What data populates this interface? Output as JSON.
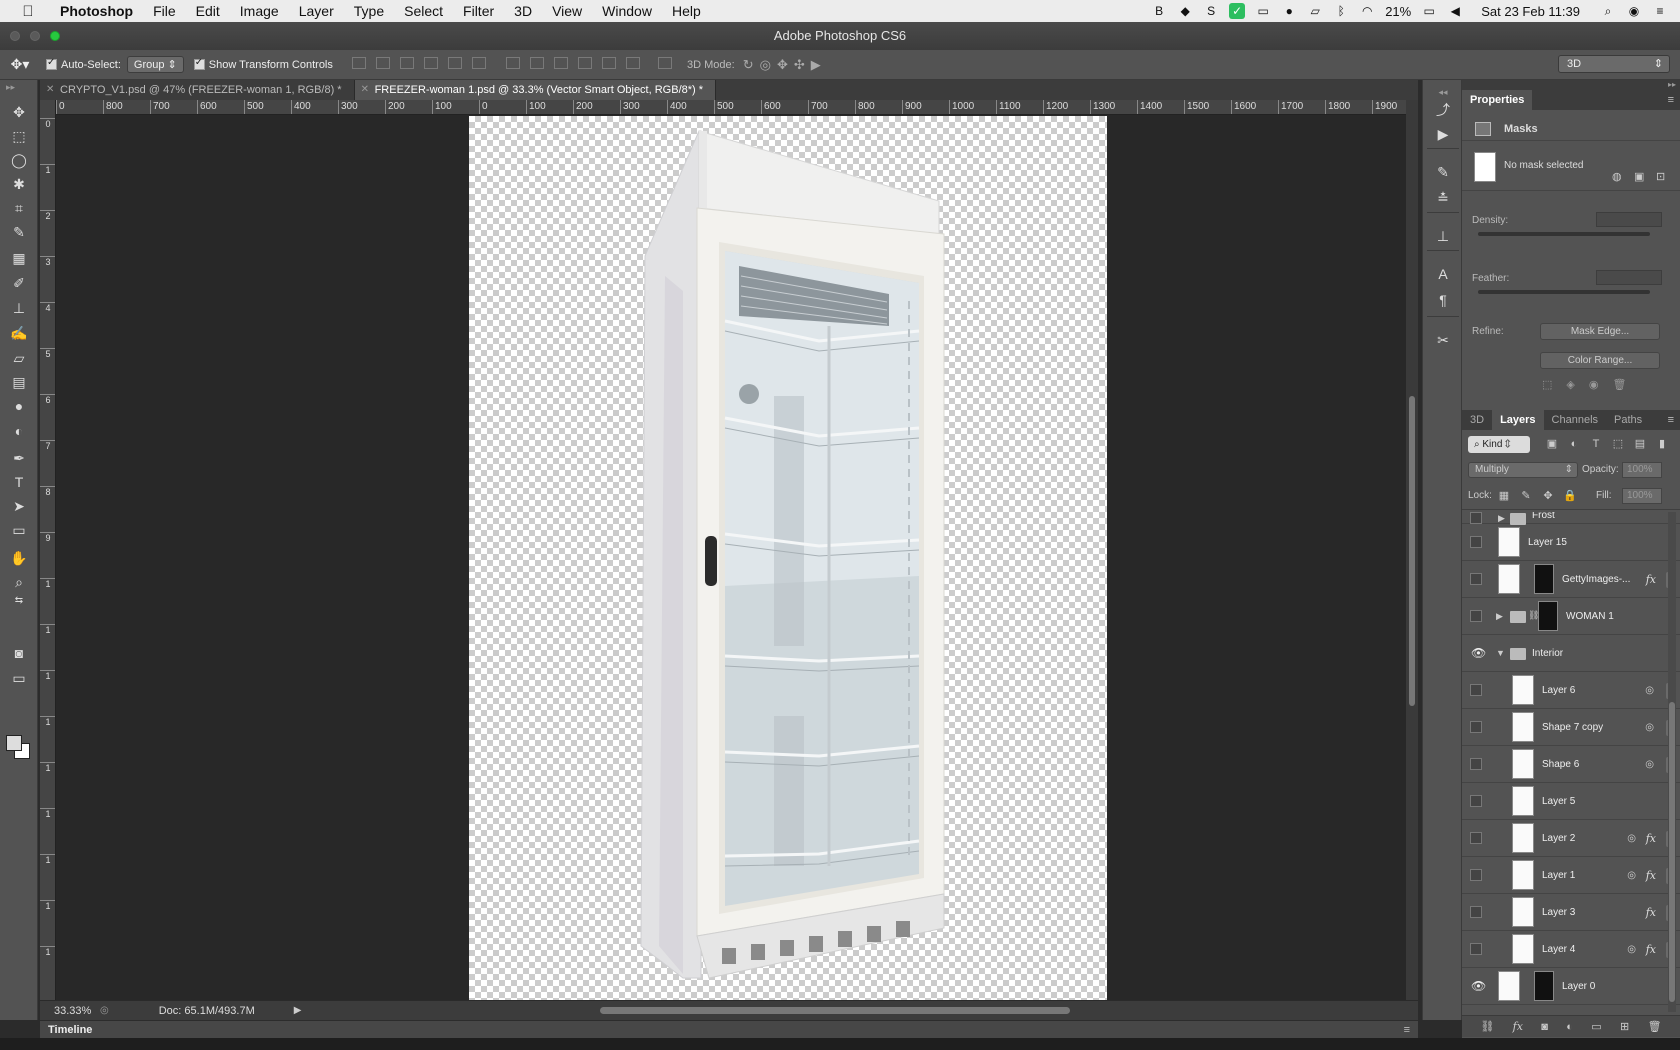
{
  "menubar": {
    "app_name": "Photoshop",
    "items": [
      "File",
      "Edit",
      "Image",
      "Layer",
      "Type",
      "Select",
      "Filter",
      "3D",
      "View",
      "Window",
      "Help"
    ],
    "battery": "21%",
    "datetime": "Sat 23 Feb  11:39"
  },
  "window": {
    "title": "Adobe Photoshop CS6"
  },
  "options": {
    "auto_select_label": "Auto-Select:",
    "auto_select_value": "Group",
    "transform_label": "Show Transform Controls",
    "mode3d_label": "3D Mode:",
    "workspace": "3D"
  },
  "tabs": [
    {
      "label": "CRYPTO_V1.psd @ 47% (FREEZER-woman 1, RGB/8) *"
    },
    {
      "label": "FREEZER-woman 1.psd @ 33.3% (Vector Smart Object, RGB/8*) *"
    }
  ],
  "ruler": {
    "h_labels": [
      "0",
      "800",
      "700",
      "600",
      "500",
      "400",
      "300",
      "200",
      "100",
      "0",
      "100",
      "200",
      "300",
      "400",
      "500",
      "600",
      "700",
      "800",
      "900",
      "1000",
      "1100",
      "1200",
      "1300",
      "1400",
      "1500",
      "1600",
      "1700",
      "1800",
      "1900"
    ],
    "v_labels": [
      "0",
      "1",
      "2",
      "3",
      "4",
      "5",
      "6",
      "7",
      "8",
      "9",
      "1",
      "1",
      "1",
      "1",
      "1",
      "1",
      "1",
      "1",
      "1"
    ]
  },
  "status": {
    "zoom": "33.33%",
    "doc": "Doc: 65.1M/493.7M"
  },
  "timeline": {
    "label": "Timeline"
  },
  "properties": {
    "title": "Properties",
    "section": "Masks",
    "no_mask": "No mask selected",
    "density_label": "Density:",
    "feather_label": "Feather:",
    "refine_label": "Refine:",
    "mask_edge_button": "Mask Edge...",
    "color_range_button": "Color Range..."
  },
  "layers_panel": {
    "tabs": [
      "3D",
      "Layers",
      "Channels",
      "Paths"
    ],
    "active_tab": "Layers",
    "kind_label": "Kind",
    "blend_mode": "Multiply",
    "opacity_label": "Opacity:",
    "opacity_value": "100%",
    "lock_label": "Lock:",
    "fill_label": "Fill:",
    "fill_value": "100%",
    "layers": [
      {
        "name": "Frost",
        "type": "group",
        "visible": false,
        "indent": 1
      },
      {
        "name": "Layer 15",
        "type": "layer",
        "visible": false
      },
      {
        "name": "GettyImages-...",
        "type": "masked",
        "visible": false,
        "fx": true
      },
      {
        "name": "WOMAN 1",
        "type": "group-masked",
        "visible": false
      },
      {
        "name": "Interior",
        "type": "group-open",
        "visible": true
      },
      {
        "name": "Layer 6",
        "type": "smart",
        "visible": false,
        "link": true
      },
      {
        "name": "Shape 7 copy",
        "type": "smart",
        "visible": false,
        "link": true
      },
      {
        "name": "Shape 6",
        "type": "smart",
        "visible": false,
        "link": true
      },
      {
        "name": "Layer 5",
        "type": "plain",
        "visible": false
      },
      {
        "name": "Layer 2",
        "type": "smart",
        "visible": false,
        "link": true,
        "fx": true
      },
      {
        "name": "Layer 1",
        "type": "smart",
        "visible": false,
        "link": true,
        "fx": true
      },
      {
        "name": "Layer 3",
        "type": "plain",
        "visible": false,
        "fx": true
      },
      {
        "name": "Layer 4",
        "type": "smart",
        "visible": false,
        "link": true,
        "fx": true
      },
      {
        "name": "Layer 0",
        "type": "masked",
        "visible": true
      }
    ]
  },
  "icons": {
    "apple": "apple-icon",
    "fx": "fx",
    "eye": "👁",
    "link": "⛓",
    "tri_right": "▶",
    "tri_down": "▼",
    "chevron": "⌃"
  }
}
